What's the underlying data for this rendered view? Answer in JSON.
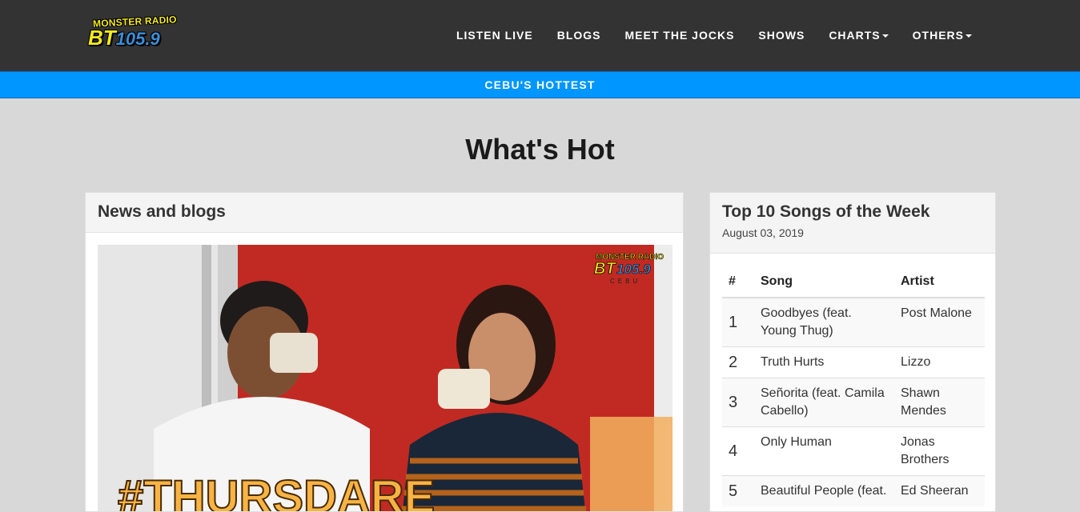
{
  "navbar": {
    "logo": {
      "line1": "MONSTER RADIO",
      "line2": "BT",
      "line3": "105.9"
    },
    "links": [
      {
        "label": "LISTEN LIVE",
        "dropdown": false
      },
      {
        "label": "BLOGS",
        "dropdown": false
      },
      {
        "label": "MEET THE JOCKS",
        "dropdown": false
      },
      {
        "label": "SHOWS",
        "dropdown": false
      },
      {
        "label": "CHARTS",
        "dropdown": true
      },
      {
        "label": "OTHERS",
        "dropdown": true
      }
    ]
  },
  "banner": {
    "text": "CEBU'S HOTTEST"
  },
  "page": {
    "title": "What's Hot"
  },
  "news": {
    "title": "News and blogs",
    "image": {
      "caption": "#THURSDARE",
      "watermark_line1": "MONSTER RADIO",
      "watermark_line2": "BT",
      "watermark_line3": "105.9",
      "watermark_city": "CEBU"
    }
  },
  "songs": {
    "title": "Top 10 Songs of the Week",
    "date": "August 03, 2019",
    "headers": {
      "rank": "#",
      "song": "Song",
      "artist": "Artist"
    },
    "rows": [
      {
        "rank": "1",
        "song": "Goodbyes (feat. Young Thug)",
        "artist": "Post Malone"
      },
      {
        "rank": "2",
        "song": "Truth Hurts",
        "artist": "Lizzo"
      },
      {
        "rank": "3",
        "song": "Señorita (feat. Camila Cabello)",
        "artist": "Shawn Mendes"
      },
      {
        "rank": "4",
        "song": "Only Human",
        "artist": "Jonas Brothers"
      },
      {
        "rank": "5",
        "song": "Beautiful People (feat.",
        "artist": "Ed Sheeran"
      }
    ]
  }
}
